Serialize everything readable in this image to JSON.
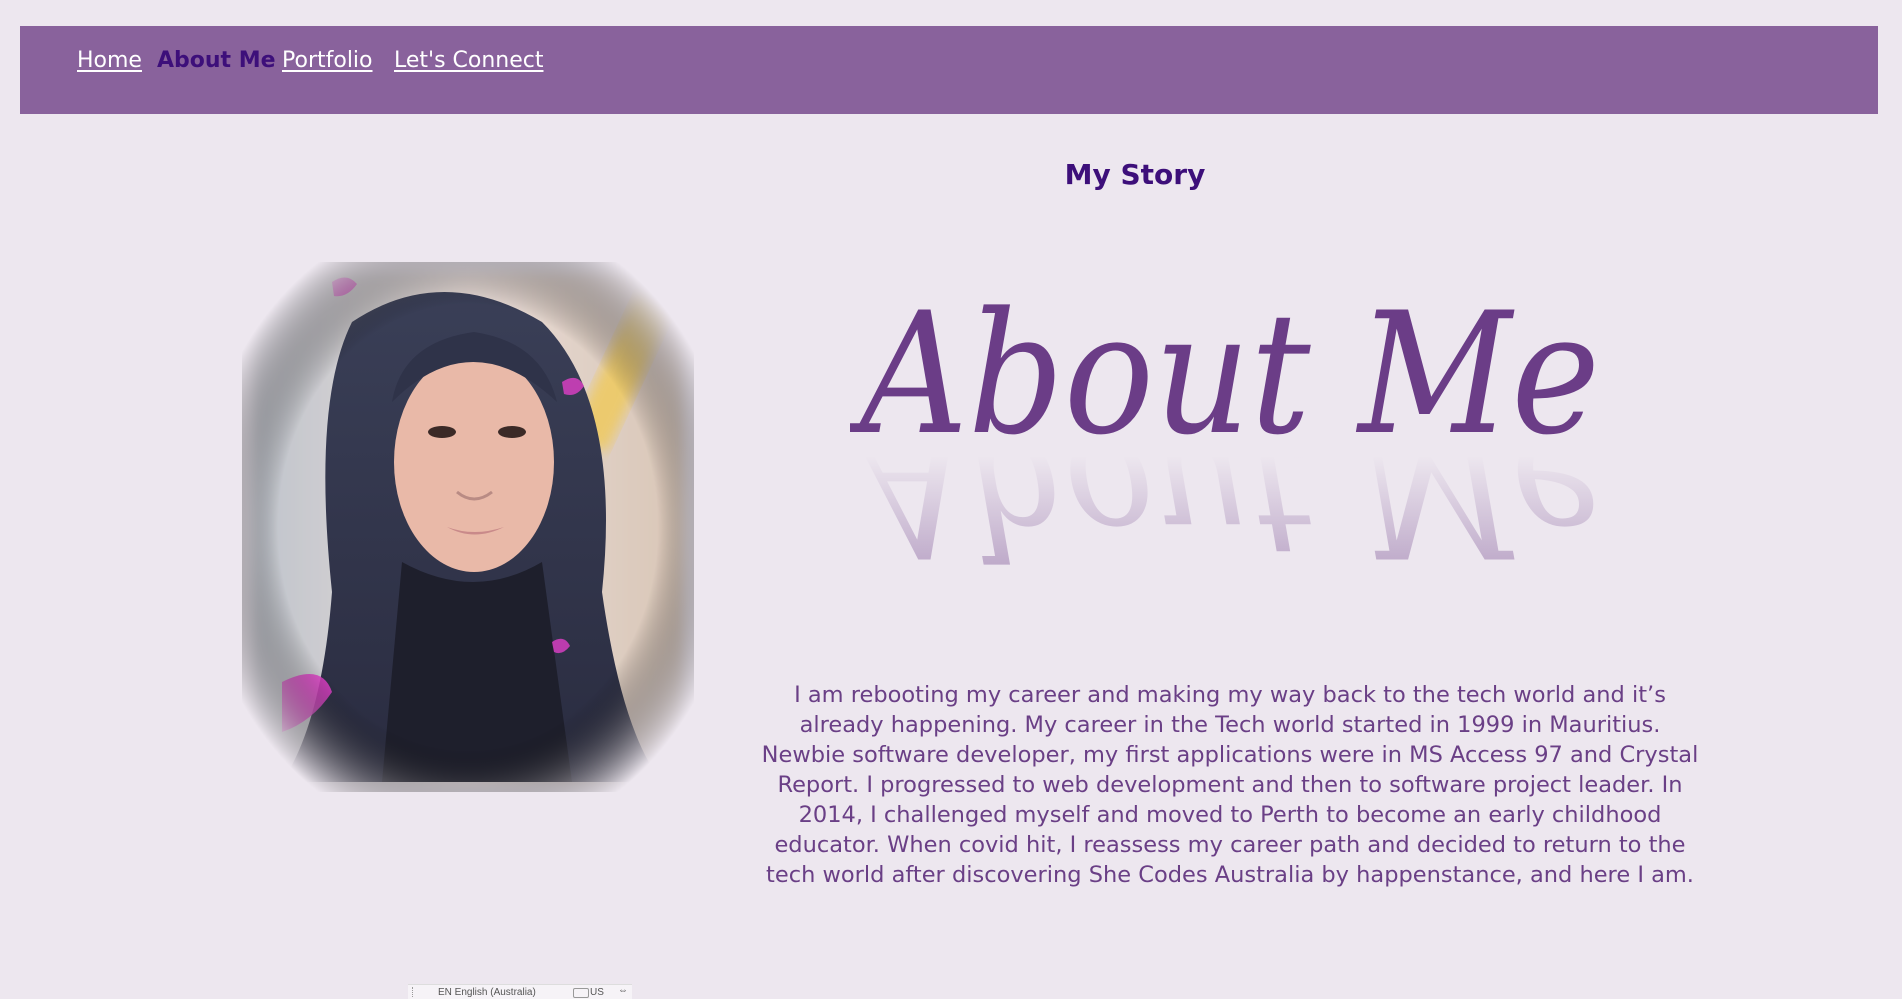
{
  "nav": {
    "items": [
      {
        "label": "Home",
        "active": false
      },
      {
        "label": "About Me",
        "active": true
      },
      {
        "label": "Portfolio",
        "active": false
      },
      {
        "label": "Let's Connect",
        "active": false
      }
    ]
  },
  "main": {
    "heading": "My Story",
    "banner_text": "About Me",
    "bio": "I am rebooting my career and making my way back to the tech world and it’s already happening. My career in the Tech world started in 1999 in Mauritius. Newbie software developer, my first applications were in MS Access 97 and Crystal Report. I progressed to web development and then to software project leader. In 2014, I challenged myself and moved to Perth to become an early childhood educator. When covid hit, I reassess my career path and decided to return to the tech world after discovering She Codes Australia by happenstance, and here I am."
  },
  "taskbar": {
    "language": "EN English (Australia)",
    "keyboard": "US"
  },
  "colors": {
    "background": "#ede7ef",
    "nav_bg": "#89629c",
    "active_link": "#3d0f7a",
    "body_text": "#6a3f86",
    "script_text": "#6b3d87"
  }
}
